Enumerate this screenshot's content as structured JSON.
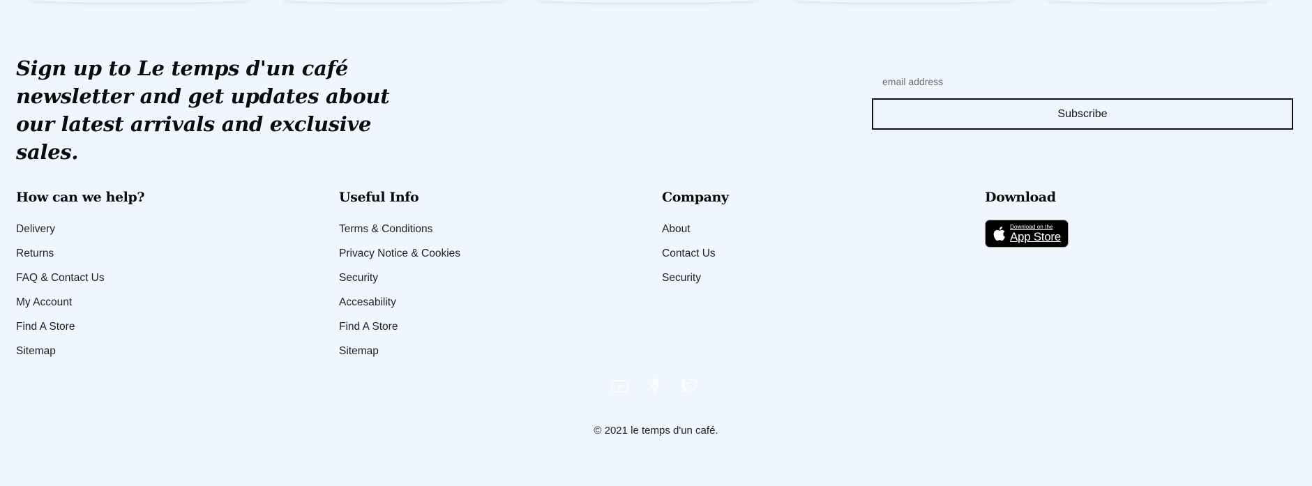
{
  "newsletter": {
    "heading": "Sign up to Le temps d'un café newsletter and get updates about our latest arrivals and exclusive sales.",
    "email_placeholder": "email address",
    "email_value": "",
    "subscribe_label": "Subscribe"
  },
  "columns": [
    {
      "heading": "How can we help?",
      "links": [
        "Delivery",
        "Returns",
        "FAQ & Contact Us",
        "My Account",
        "Find A Store",
        "Sitemap"
      ]
    },
    {
      "heading": "Useful Info",
      "links": [
        "Terms & Conditions",
        "Privacy Notice & Cookies",
        "Security",
        "Accesability",
        "Find A Store",
        "Sitemap"
      ]
    },
    {
      "heading": "Company",
      "links": [
        "About",
        "Contact Us",
        "Security"
      ]
    },
    {
      "heading": "Download",
      "app_store": {
        "small": "Download on the",
        "big": "App Store",
        "icon": "apple-icon"
      }
    }
  ],
  "social": [
    {
      "icon": "youtube-icon",
      "color": "#ffffff"
    },
    {
      "icon": "facebook-icon",
      "color": "#ffffff"
    },
    {
      "icon": "twitter-icon",
      "color": "#ffffff"
    }
  ],
  "footer": {
    "copyright": "© 2021 le temps d'un café."
  },
  "colors": {
    "background": "#eff6fd",
    "text": "#111111",
    "button_border": "#111111"
  }
}
